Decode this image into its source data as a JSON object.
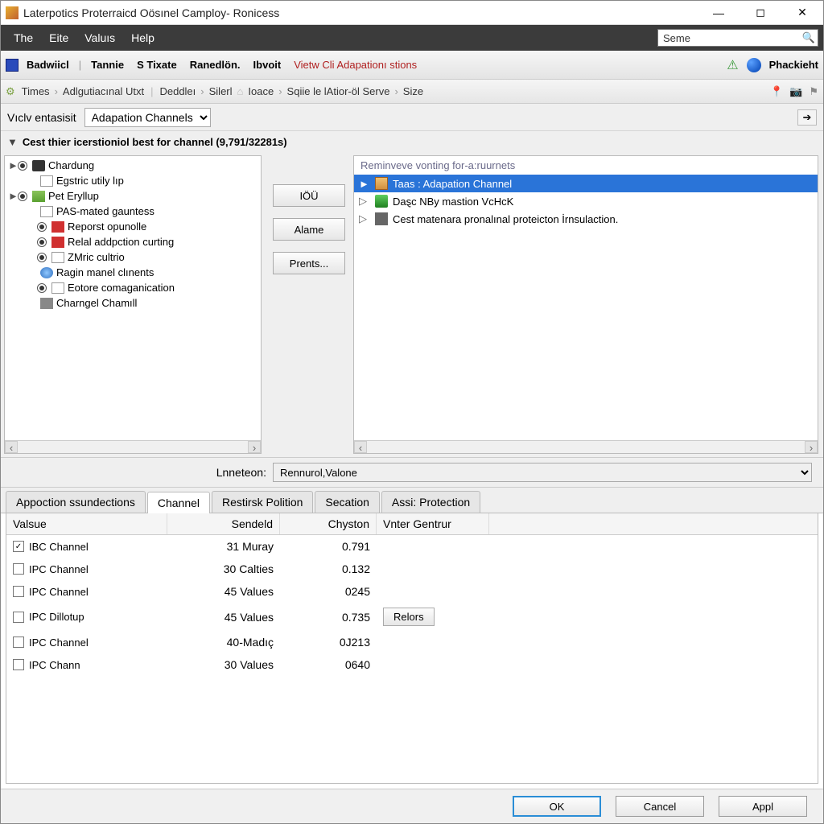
{
  "window": {
    "title": "Laterpotics Proterraicd Oösınel Camploy- Ronicess"
  },
  "menubar": {
    "items": [
      "The",
      "Eite",
      "Valuıs",
      "Help"
    ],
    "search_value": "Seme"
  },
  "toolbar": {
    "buttons": [
      "Badwiicl",
      "Tannie",
      "S Tixate",
      "Ranedlön.",
      "Ibvoit"
    ],
    "view_link": "Vietw Cli Adapationı stions",
    "phackient": "Phackieht"
  },
  "breadcrumb": {
    "items": [
      "Times",
      "Adlgutiacınal Utxt",
      "Deddleı",
      "Silerl",
      "Ioace",
      "Sqiie le lAtior-öl Serve",
      "Size"
    ]
  },
  "view_row": {
    "label": "Vıclv entasisit",
    "dropdown": "Adapation Channels"
  },
  "filter_text": "Cest thier icerstioniol best for channel (9,791/32281s)",
  "tree": [
    {
      "lvl": 1,
      "exp": "►",
      "radio": true,
      "radio_on": true,
      "icon": "ti-cam",
      "label": "Chardung"
    },
    {
      "lvl": 2,
      "icon": "ti-doc",
      "label": "Egstric utily lıp"
    },
    {
      "lvl": 1,
      "exp": "►",
      "radio": true,
      "radio_on": true,
      "icon": "ti-server",
      "label": "Pet Eryllup"
    },
    {
      "lvl": 2,
      "icon": "ti-doc",
      "label": "PAS-mated gauntess"
    },
    {
      "lvl": 2,
      "radio": true,
      "radio_on": true,
      "icon": "ti-redsq",
      "label": "Reporst opunolle"
    },
    {
      "lvl": 2,
      "radio": true,
      "radio_on": true,
      "icon": "ti-redsq",
      "label": "Relal addpction curting"
    },
    {
      "lvl": 2,
      "radio": true,
      "radio_on": true,
      "icon": "ti-doc",
      "label": "ZMric cultrio"
    },
    {
      "lvl": 2,
      "icon": "ti-globe",
      "label": "Ragin manel clınents"
    },
    {
      "lvl": 2,
      "radio": true,
      "radio_on": true,
      "icon": "ti-doc",
      "label": "Eotore comaganication"
    },
    {
      "lvl": 2,
      "icon": "ti-chip",
      "label": "Charngel Chamıll"
    }
  ],
  "mid_buttons": {
    "b1": "IÖÜ",
    "b2": "Alame",
    "b3": "Prents..."
  },
  "right_pane": {
    "header": "Reminveve vonting for-a:ruurnets",
    "items": [
      {
        "selected": true,
        "exp": "►",
        "icon": "rp-ic1",
        "label": "Taas : Adapation Channel"
      },
      {
        "selected": false,
        "exp": "▷",
        "icon": "rp-ic2",
        "label": "Daȿc NBy mastion VcHcK"
      },
      {
        "selected": false,
        "exp": "▷",
        "icon": "rp-ic3",
        "label": "Cest matenara pronalınal proteicton İrnsulaction."
      }
    ]
  },
  "lnneteon": {
    "label": "Lnneteon:",
    "value": "Rennurol,Valone"
  },
  "tabs": [
    "Appoction ssundections",
    "Channel",
    "Restirsk Polition",
    "Secation",
    "Assi: Protection"
  ],
  "active_tab": 1,
  "grid": {
    "headers": [
      "Valsue",
      "Sendeld",
      "Chyston",
      "Vnter Gentrur"
    ],
    "rows": [
      {
        "chk": true,
        "c0": "IBC Channel",
        "c1": "31 Muray",
        "c2": "0.791",
        "btn": ""
      },
      {
        "chk": false,
        "c0": "IPC Channel",
        "c1": "30 Calties",
        "c2": "0.132",
        "btn": ""
      },
      {
        "chk": false,
        "c0": "IPC Channel",
        "c1": "45 Values",
        "c2": "0245",
        "btn": ""
      },
      {
        "chk": false,
        "c0": "IPC Dillotup",
        "c1": "45 Values",
        "c2": "0.735",
        "btn": "Relors"
      },
      {
        "chk": false,
        "c0": "IPC Channel",
        "c1": "40-Madıç",
        "c2": "0J213",
        "btn": ""
      },
      {
        "chk": false,
        "c0": "IPC Chann",
        "c1": "30 Values",
        "c2": "0640",
        "btn": ""
      }
    ]
  },
  "dialog": {
    "ok": "OK",
    "cancel": "Cancel",
    "appl": "Appl"
  }
}
